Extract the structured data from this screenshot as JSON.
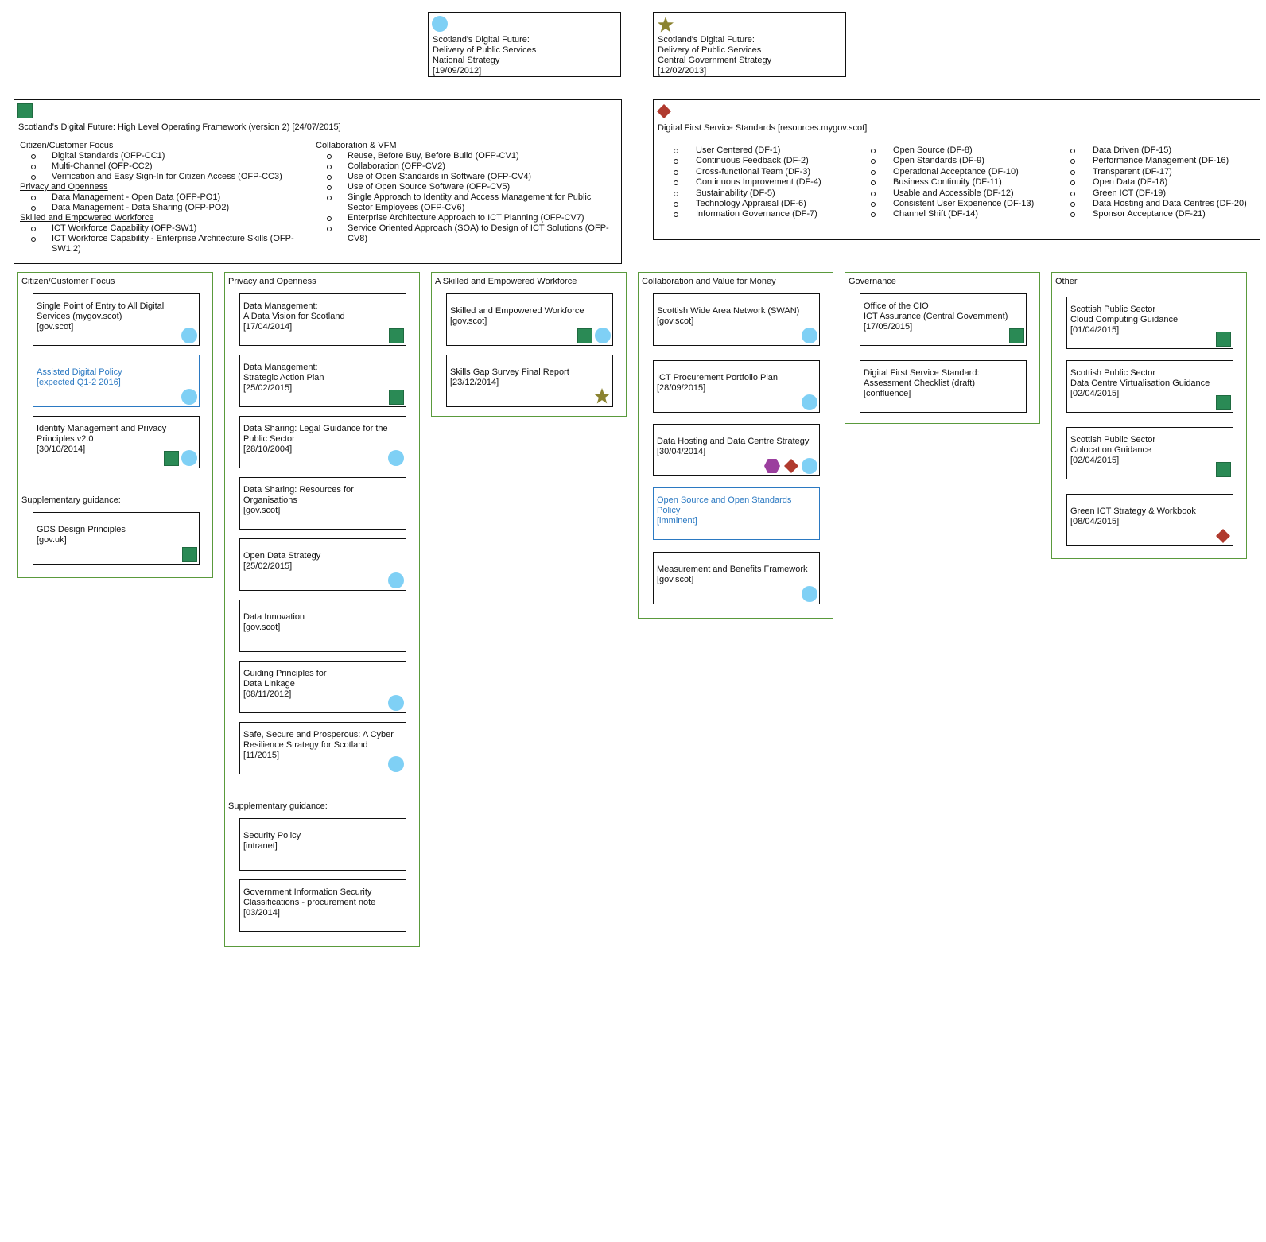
{
  "national_strategy": {
    "icon": "circle",
    "lines": "Scotland's Digital Future:\nDelivery of Public Services\nNational Strategy\n[19/09/2012]"
  },
  "central_strategy": {
    "icon": "star",
    "lines": "Scotland's Digital Future:\nDelivery of Public Services\nCentral Government Strategy\n[12/02/2013]"
  },
  "framework": {
    "icon": "square",
    "title": "Scotland's Digital Future: High Level Operating Framework (version 2) [24/07/2015]",
    "left": [
      {
        "heading": "Citizen/Customer Focus",
        "items": [
          "Digital Standards (OFP-CC1)",
          "Multi-Channel (OFP-CC2)",
          "Verification and Easy Sign-In for Citizen Access (OFP-CC3)"
        ]
      },
      {
        "heading": "Privacy and Openness",
        "items": [
          "Data Management - Open Data (OFP-PO1)",
          "Data Management - Data Sharing (OFP-PO2)"
        ]
      },
      {
        "heading": "Skilled and Empowered Workforce",
        "items": [
          "ICT Workforce Capability (OFP-SW1)",
          "ICT Workforce Capability - Enterprise Architecture Skills (OFP-SW1.2)"
        ]
      }
    ],
    "right": [
      {
        "heading": "Collaboration & VFM",
        "items": [
          "Reuse, Before Buy, Before Build (OFP-CV1)",
          "Collaboration (OFP-CV2)",
          "Use of Open Standards in Software (OFP-CV4)",
          "Use of Open Source Software (OFP-CV5)",
          "Single Approach to Identity and Access Management for Public Sector Employees (OFP-CV6)",
          "Enterprise Architecture Approach to ICT Planning (OFP-CV7)",
          "Service Oriented Approach (SOA) to Design of ICT Solutions (OFP-CV8)"
        ]
      }
    ]
  },
  "standards": {
    "icon": "diamond",
    "title": "Digital First Service Standards [resources.mygov.scot]",
    "columns": [
      [
        "User Centered (DF-1)",
        "Continuous Feedback (DF-2)",
        "Cross-functional Team (DF-3)",
        "Continuous Improvement (DF-4)",
        "Sustainability (DF-5)",
        "Technology Appraisal (DF-6)",
        "Information Governance (DF-7)"
      ],
      [
        "Open Source (DF-8)",
        "Open Standards (DF-9)",
        "Operational Acceptance (DF-10)",
        "Business Continuity (DF-11)",
        "Usable and Accessible (DF-12)",
        "Consistent User Experience (DF-13)",
        "Channel Shift (DF-14)"
      ],
      [
        "Data Driven (DF-15)",
        "Performance Management (DF-16)",
        "Transparent (DF-17)",
        "Open Data (DF-18)",
        "Green ICT (DF-19)",
        "Data Hosting and Data Centres (DF-20)",
        "Sponsor Acceptance (DF-21)"
      ]
    ]
  },
  "groups": [
    {
      "title": "Citizen/Customer Focus",
      "supplementary_label": "Supplementary guidance:",
      "cards": [
        {
          "text": "Single Point of Entry to All Digital\nServices (mygov.scot)\n[gov.scot]",
          "icons": [
            "circle"
          ]
        },
        {
          "text": "Assisted Digital Policy\n[expected Q1-2 2016]",
          "icons": [
            "circle"
          ],
          "blue": true
        },
        {
          "text": "Identity Management and Privacy\nPrinciples v2.0\n[30/10/2014]",
          "icons": [
            "square",
            "circle"
          ]
        }
      ],
      "supplementary": [
        {
          "text": "GDS Design Principles\n[gov.uk]",
          "icons": [
            "square"
          ]
        }
      ]
    },
    {
      "title": "Privacy and Openness",
      "supplementary_label": "Supplementary guidance:",
      "cards": [
        {
          "text": "Data Management:\nA Data Vision for Scotland\n[17/04/2014]",
          "icons": [
            "square"
          ]
        },
        {
          "text": "Data Management:\nStrategic Action Plan\n[25/02/2015]",
          "icons": [
            "square"
          ]
        },
        {
          "text": "Data Sharing: Legal Guidance for the\nPublic Sector\n[28/10/2004]",
          "icons": [
            "circle"
          ]
        },
        {
          "text": "Data Sharing: Resources for\nOrganisations\n[gov.scot]",
          "icons": []
        },
        {
          "text": "Open Data Strategy\n[25/02/2015]",
          "icons": [
            "circle"
          ]
        },
        {
          "text": "Data Innovation\n[gov.scot]",
          "icons": []
        },
        {
          "text": "Guiding Principles for\nData Linkage\n[08/11/2012]",
          "icons": [
            "circle"
          ]
        },
        {
          "text": "Safe, Secure and Prosperous: A Cyber\nResilience Strategy for Scotland\n[11/2015]",
          "icons": [
            "circle"
          ]
        }
      ],
      "supplementary": [
        {
          "text": "Security Policy\n[intranet]",
          "icons": []
        },
        {
          "text": "Government Information Security\nClassifications - procurement note\n[03/2014]",
          "icons": []
        }
      ]
    },
    {
      "title": "A Skilled and Empowered Workforce",
      "cards": [
        {
          "text": "Skilled and Empowered Workforce\n[gov.scot]",
          "icons": [
            "square",
            "circle"
          ]
        },
        {
          "text": "Skills Gap Survey Final Report\n[23/12/2014]",
          "icons": [
            "star"
          ]
        }
      ]
    },
    {
      "title": "Collaboration and Value for Money",
      "cards": [
        {
          "text": "Scottish Wide Area Network (SWAN)\n[gov.scot]",
          "icons": [
            "circle"
          ]
        },
        {
          "text": "ICT Procurement Portfolio Plan\n[28/09/2015]",
          "icons": [
            "circle"
          ]
        },
        {
          "text": "Data Hosting and Data Centre Strategy\n[30/04/2014]",
          "icons": [
            "hexagon",
            "diamond",
            "circle"
          ]
        },
        {
          "text": "Open Source and Open Standards\nPolicy\n[imminent]",
          "icons": [],
          "blue": true
        },
        {
          "text": "Measurement and Benefits Framework\n[gov.scot]",
          "icons": [
            "circle"
          ]
        }
      ]
    },
    {
      "title": "Governance",
      "cards": [
        {
          "text": "Office of the CIO\nICT Assurance (Central Government)\n[17/05/2015]",
          "icons": [
            "square"
          ]
        },
        {
          "text": "Digital First Service Standard:\nAssessment Checklist (draft)\n[confluence]",
          "icons": []
        }
      ]
    },
    {
      "title": "Other",
      "cards": [
        {
          "text": "Scottish Public Sector\nCloud Computing Guidance\n[01/04/2015]",
          "icons": [
            "square"
          ]
        },
        {
          "text": "Scottish Public Sector\nData Centre Virtualisation Guidance\n[02/04/2015]",
          "icons": [
            "square"
          ]
        },
        {
          "text": "Scottish Public Sector\nColocation Guidance\n[02/04/2015]",
          "icons": [
            "square"
          ]
        },
        {
          "text": "Green ICT Strategy & Workbook\n[08/04/2015]",
          "icons": [
            "diamond"
          ]
        }
      ]
    }
  ],
  "colors": {
    "circle": "#7fd0f5",
    "square": "#2a8a55",
    "diamond": "#b03a2e",
    "star": "#8b8330",
    "hexagon": "#9b3f9e",
    "group_border": "#5a9a3c",
    "link_blue": "#2b79c2"
  }
}
